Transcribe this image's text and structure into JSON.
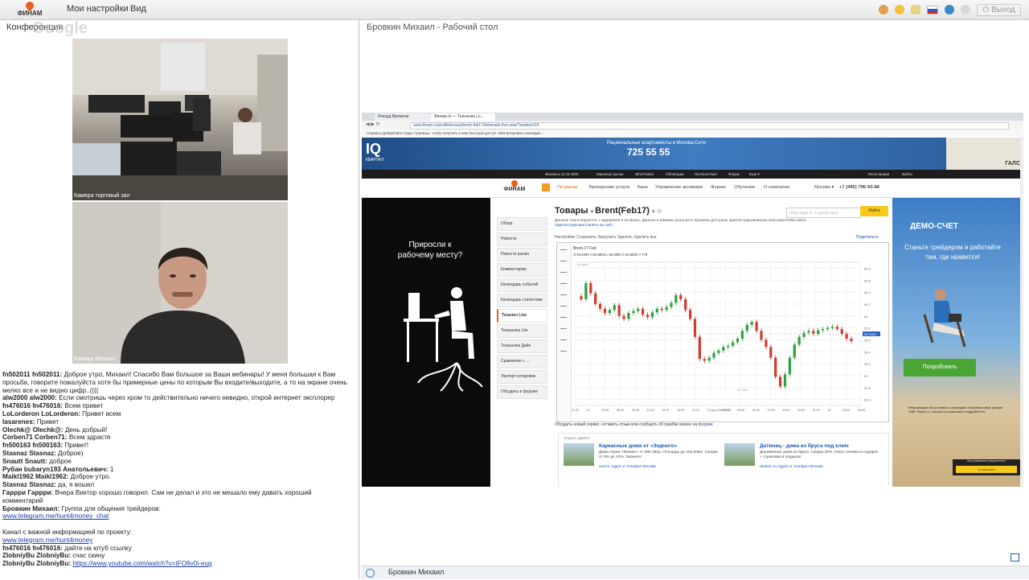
{
  "topbar": {
    "logo_text": "ФИНАМ",
    "menu": [
      "Мои настройки",
      "Вид"
    ],
    "logout": "Выход",
    "colors": {
      "accent": "#e8601c"
    }
  },
  "left_panel": {
    "title": "Конференция",
    "cameras": [
      {
        "label": "Камера торговый зал"
      },
      {
        "label": "Камера Михаил"
      }
    ]
  },
  "chat": [
    {
      "name": "fn502011 fn502011:",
      "text": "Доброе утро, Михаил! Спасибо Вам большое за Ваши вебинары! У меня большая к Вам просьба, говорите пожалуйста хотя бы примерные цены по которым Вы входите/выходите, а то на экране очень мелко все и не видно цифр..(((("
    },
    {
      "name": "alw2000 alw2000:",
      "text": "Если смотришь через хром то действительно ничего невидно, открой интернет эксплорер"
    },
    {
      "name": "fn476016 fn476016:",
      "text": "Всем привет"
    },
    {
      "name": "LoLorderon LoLorderon:",
      "text": "Привет всем"
    },
    {
      "name": "lasarenes:",
      "text": "Привет"
    },
    {
      "name": "Olechk@ Olechk@:",
      "text": "День добрый!"
    },
    {
      "name": "Corben71 Corben71:",
      "text": "Всем здрасте"
    },
    {
      "name": "fn500163 fn500163:",
      "text": "Привет!"
    },
    {
      "name": "Stasnaz Stasnaz:",
      "text": "Доброе)"
    },
    {
      "name": "Snautt Snautt:",
      "text": "доброе"
    },
    {
      "name": "Рубан bubaryn193 Анатольевич:",
      "text": "1"
    },
    {
      "name": "Maikl1962 Maikl1962:",
      "text": "Доброе утро."
    },
    {
      "name": "Stasnaz Stasnaz:",
      "text": "да, я вошел"
    },
    {
      "name": "Гаррри Гаррри:",
      "text": "Вчера Виктор хорошо говорил. Сам не делал и это не мешало ему давать хороший комментарий"
    },
    {
      "name": "Бровкин Михаил:",
      "text": "Группа для общения трейдеров:"
    },
    {
      "link": "www.telegram.me/hunt4money_chat"
    },
    {
      "text": ""
    },
    {
      "text": "Канал с важной информацией по проекту:"
    },
    {
      "link": "www.telegram.me/hunt4money"
    },
    {
      "name": "fn476016 fn476016:",
      "text": "дайте на ютуб ссылку"
    },
    {
      "name": "ZlobniyBu ZlobniyBu:",
      "text": "счас скину"
    },
    {
      "name": "ZlobniyBu ZlobniyBu:",
      "link": "https://www.youtube.com/watch?v=tFO6v0i-eug"
    }
  ],
  "right_panel": {
    "title": "Бровкин Михаил - Рабочий стол",
    "footer_user": "Бровкин Михаил"
  },
  "browser": {
    "tabs": [
      "Рекорд Времени",
      "Финам.ru — Технализ Lo..."
    ],
    "url": "www.finam.ru/profile/tovary/brent-feb17/tehanaliz-live-new/?market=24",
    "bookmarks": "Сервисы   Добавляйте сюда страницы, чтобы получать к ним быстрый доступ.  Импортировать закладки..."
  },
  "site": {
    "banner": {
      "brand": "IQ",
      "brand_sub": "КВАРТАЛ",
      "promo": "Рациональные апартаменты в Москва-Сити",
      "phone": "725 55 55",
      "partner": "ГАЛС"
    },
    "topnav": [
      "Финансы  11:01 МSК",
      "Мировые рынки",
      "WhoTrades",
      "Облигации",
      "Путешествия",
      "Форум",
      "Ещё ▾",
      "Регистрация",
      "Войти"
    ],
    "logo": "ФИНАМ",
    "menu": [
      "По рынке",
      "Брокерские услуги",
      "Банк",
      "Управление активами",
      "Форекс",
      "Обучение",
      "О компании"
    ],
    "region": "Москва ▾",
    "phone": "+7 (495) 796-93-88"
  },
  "left_ad": {
    "text": "Приросли к рабочему месту?"
  },
  "side_menu": [
    "Обзор",
    "Новости",
    "Новости рынка",
    "Комментарии",
    "Календарь событий",
    "Календарь статистики",
    "Техализ Live",
    "Теханализ Lite",
    "Теханализ Дайн",
    "Сравнение с ...",
    "Экспорт котировок",
    "Обсудить в форуме"
  ],
  "content": {
    "title_left": "Товары",
    "title_main": "Brent(Feb17)",
    "subtitle": "Данные транслируются с задержкой в 15 минут. Данные в режиме реального времени доступны зарегистрированным пользователям сайта",
    "subtitle_link": "Зарегистрировать/войти на сайт",
    "search_placeholder": "Сбер Apple $ - в одном порту",
    "search_button": "Найти",
    "tools": "Настройки:  Сохранить   Загрузить   Удалить   Удалить все",
    "share": "Поделиться",
    "feedback": "Обсудить новый сервис, оставить отзыв или сообщить об ошибке можно на",
    "feedback_link": "форуме"
  },
  "chart_data": {
    "type": "candlestick",
    "title": "Brent.17 Feb",
    "legend": "O 53.6400  H 53.6600  L 53.6000  C 53.6500  V 778",
    "x_ticks": [
      "21:00",
      "14",
      "03:00",
      "06:00",
      "09:00",
      "12:00",
      "15:00",
      "18:00",
      "21:00",
      "15 дек 2016 00:00",
      "03:00",
      "06:00",
      "09:00",
      "12:00",
      "15:00",
      "18:00",
      "21:00",
      "16",
      "03:00",
      "06:00"
    ],
    "y_ticks": [
      54.8,
      54.6,
      54.4,
      54.2,
      54.0,
      53.8,
      53.6,
      53.4,
      53.2,
      53.0,
      52.8,
      52.6
    ],
    "y_range": [
      52.5,
      54.9
    ],
    "last_price": 53.7,
    "annotations": [
      "54.8600",
      "52.7600"
    ],
    "series": [
      {
        "values": [
          54.28,
          54.55,
          54.38,
          54.2,
          54.12,
          54.05,
          54.1,
          54.18,
          54.0,
          53.95,
          54.05,
          54.08,
          54.12,
          54.02,
          53.98,
          54.06,
          54.12,
          54.1,
          54.15,
          54.22,
          54.35,
          54.28,
          54.1,
          53.95,
          53.65,
          53.28,
          53.25,
          53.3,
          53.38,
          53.42,
          53.48,
          53.5,
          53.56,
          53.62,
          53.75,
          53.85,
          53.9,
          53.75,
          53.6,
          53.48,
          53.3,
          52.98,
          52.82,
          53.02,
          53.3,
          53.52,
          53.65,
          53.72,
          53.75,
          53.7,
          53.76,
          53.78,
          53.8,
          53.82,
          53.78,
          53.7,
          53.62,
          53.58
        ]
      }
    ]
  },
  "yandex": {
    "header": "Яндекс.Директ",
    "ads": [
      {
        "title": "Каркасные дома от «Зодчего»",
        "desc": "Дома серии «Финикс» от 656 390р. Площадь до 153,00м2. Скидки от 5% до 10%. Звоните!",
        "domain": "zod.ru   Адрес и телефон   Москва"
      },
      {
        "title": "Детинец - дома из бруса под ключ",
        "desc": "Деревянные дома из бруса. Скидка 20%. Плюс техника в подарок + страховка в подарок!",
        "domain": "detinec.ru   Адрес и телефон   Москва"
      }
    ]
  },
  "right_ad": {
    "heading": "ДЕМО-СЧЕТ",
    "text": "Станьте трейдером и работайте там, где нравится!",
    "button": "Попробовать",
    "small": "Информация об условиях и операциях на финансовых рынках. Сайт: finam.ru. Ссылка на лицензию и подробности",
    "notice": "Настраиваемое уведомление",
    "notice_button": "Остановить"
  }
}
